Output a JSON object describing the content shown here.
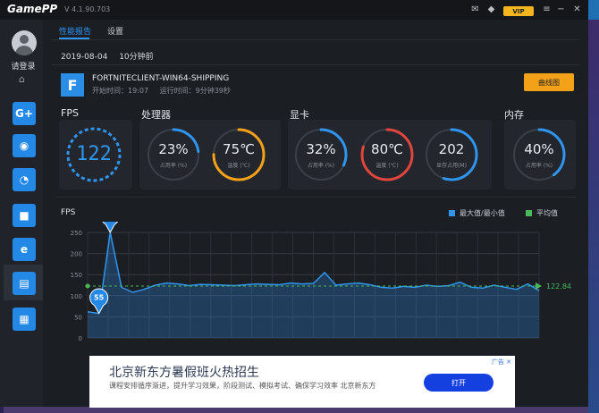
{
  "app": {
    "logo": "GamePP",
    "version": "V 4.1.90.703",
    "vip": "VIP"
  },
  "sidebar": {
    "login": "请登录",
    "nav": [
      "G+",
      "eye",
      "gauge",
      "video",
      "boost",
      "clipboard",
      "report"
    ]
  },
  "tabs": [
    {
      "label": "性能报告",
      "active": true
    },
    {
      "label": "设置",
      "active": false
    }
  ],
  "session": {
    "date": "2019-08-04",
    "duration": "10分钟前"
  },
  "game": {
    "name": "FORTNITECLIENT-WIN64-SHIPPING",
    "start": "开始时间：19:07",
    "run": "运行时间：9分钟39秒",
    "button": "曲线图"
  },
  "sections": {
    "fps": "FPS",
    "cpu": "处理器",
    "gpu": "显卡",
    "mem": "内存"
  },
  "metrics": {
    "fps": {
      "value": "122"
    },
    "cpu_usage": {
      "value": "23%",
      "label": "占用率 (%)",
      "fraction": 0.23
    },
    "cpu_temp": {
      "value": "75℃",
      "label": "温度 (℃)",
      "fraction": 0.75
    },
    "gpu_usage": {
      "value": "32%",
      "label": "占用率 (%)",
      "fraction": 0.32
    },
    "gpu_temp": {
      "value": "80℃",
      "label": "温度 (℃)",
      "fraction": 0.8
    },
    "gpu_mem": {
      "value": "202",
      "label": "显存占用(M)",
      "fraction": 0.55
    },
    "mem_usage": {
      "value": "40%",
      "label": "占用率 (%)",
      "fraction": 0.4
    }
  },
  "colors": {
    "accent": "#2f95f1",
    "cpu_temp": "#f4a11a",
    "gpu_temp": "#e0463d",
    "avg": "#4ab85a"
  },
  "chart_data": {
    "type": "area",
    "title": "FPS",
    "legend": [
      "最大值/最小值",
      "平均值"
    ],
    "legend_position": "top-right",
    "ylim": [
      0,
      250
    ],
    "yticks": [
      "0",
      "50",
      "100",
      "150",
      "200",
      "250"
    ],
    "grid": true,
    "values": [
      62,
      58,
      250,
      120,
      108,
      115,
      125,
      130,
      128,
      124,
      127,
      126,
      125,
      124,
      126,
      128,
      127,
      126,
      130,
      128,
      129,
      155,
      125,
      128,
      130,
      126,
      120,
      118,
      122,
      120,
      125,
      122,
      124,
      132,
      120,
      118,
      125,
      120,
      115,
      128,
      112
    ],
    "max_label": "250",
    "min_label": "55",
    "average": 122.84,
    "average_label": "122.84"
  },
  "ad": {
    "title": "北京新东方暑假班火热招生",
    "desc": "课程安排循序渐进，提升学习效果，阶段测试、模拟考试、确保学习效率 北京新东方",
    "button": "打开",
    "tag": "广告 ✕"
  }
}
